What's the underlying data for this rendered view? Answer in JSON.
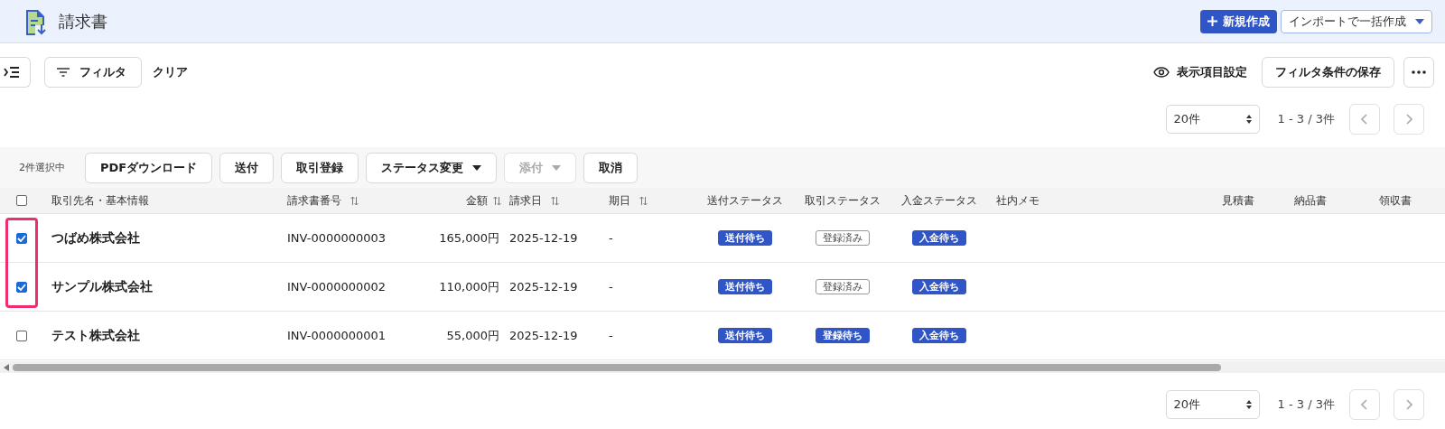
{
  "header": {
    "title": "請求書",
    "new_button": "新規作成",
    "import_button": "インポートで一括作成"
  },
  "toolbar": {
    "filter_button": "フィルタ",
    "clear_link": "クリア",
    "columns_link": "表示項目設定",
    "save_filter_button": "フィルタ条件の保存"
  },
  "pager_top": {
    "per_page": "20件",
    "range": "1 - 3 / 3件"
  },
  "selection_bar": {
    "count": "2件選択中",
    "actions": [
      {
        "label": "PDFダウンロード",
        "dropdown": false,
        "disabled": false
      },
      {
        "label": "送付",
        "dropdown": false,
        "disabled": false
      },
      {
        "label": "取引登録",
        "dropdown": false,
        "disabled": false
      },
      {
        "label": "ステータス変更",
        "dropdown": true,
        "disabled": false
      },
      {
        "label": "添付",
        "dropdown": true,
        "disabled": true
      },
      {
        "label": "取消",
        "dropdown": false,
        "disabled": false
      }
    ]
  },
  "table": {
    "all_selected": false,
    "columns": [
      {
        "label": "取引先名・基本情報",
        "sortable": false
      },
      {
        "label": "請求書番号",
        "sortable": true
      },
      {
        "label": "金額",
        "sortable": true
      },
      {
        "label": "請求日",
        "sortable": true
      },
      {
        "label": "期日",
        "sortable": true
      },
      {
        "label": "送付ステータス",
        "sortable": false
      },
      {
        "label": "取引ステータス",
        "sortable": false
      },
      {
        "label": "入金ステータス",
        "sortable": false
      },
      {
        "label": "社内メモ",
        "sortable": false
      },
      {
        "label": "見積書",
        "sortable": false
      },
      {
        "label": "納品書",
        "sortable": false
      },
      {
        "label": "領収書",
        "sortable": false
      }
    ],
    "rows": [
      {
        "selected": true,
        "name": "つばめ株式会社",
        "invoice": "INV-0000000003",
        "amount": "165,000円",
        "date": "2025-12-19",
        "due": "-",
        "statuses": [
          {
            "label": "送付待ち",
            "kind": "filled"
          },
          {
            "label": "登録済み",
            "kind": "outline"
          },
          {
            "label": "入金待ち",
            "kind": "filled"
          }
        ]
      },
      {
        "selected": true,
        "name": "サンプル株式会社",
        "invoice": "INV-0000000002",
        "amount": "110,000円",
        "date": "2025-12-19",
        "due": "-",
        "statuses": [
          {
            "label": "送付待ち",
            "kind": "filled"
          },
          {
            "label": "登録済み",
            "kind": "outline"
          },
          {
            "label": "入金待ち",
            "kind": "filled"
          }
        ]
      },
      {
        "selected": false,
        "name": "テスト株式会社",
        "invoice": "INV-0000000001",
        "amount": "55,000円",
        "date": "2025-12-19",
        "due": "-",
        "statuses": [
          {
            "label": "送付待ち",
            "kind": "filled"
          },
          {
            "label": "登録待ち",
            "kind": "filled"
          },
          {
            "label": "入金待ち",
            "kind": "filled"
          }
        ]
      }
    ]
  },
  "highlight": {
    "kind": "box"
  },
  "pager_bottom": {
    "per_page": "20件",
    "range": "1 - 3 / 3件"
  }
}
